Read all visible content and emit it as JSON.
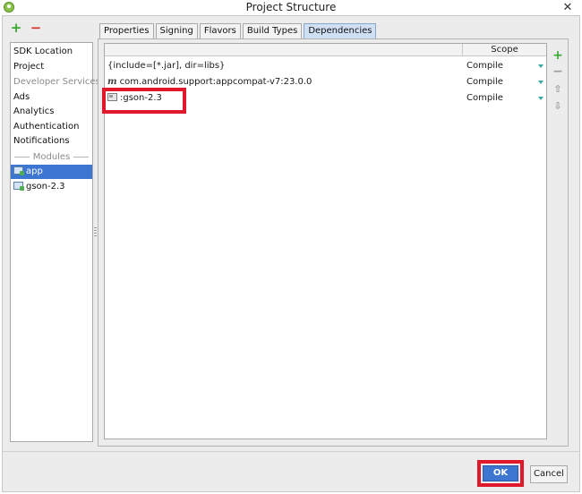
{
  "window": {
    "title": "Project Structure",
    "close_glyph": "✕"
  },
  "left_toolbar": {
    "add_glyph": "+",
    "remove_glyph": "−"
  },
  "sidebar": {
    "items": [
      {
        "label": "SDK Location"
      },
      {
        "label": "Project"
      },
      {
        "label": "Developer Services"
      },
      {
        "label": "Ads"
      },
      {
        "label": "Analytics"
      },
      {
        "label": "Authentication"
      },
      {
        "label": "Notifications"
      }
    ],
    "modules_label": "Modules",
    "modules": [
      {
        "label": "app",
        "selected": true
      },
      {
        "label": "gson-2.3",
        "selected": false
      }
    ]
  },
  "tabs": [
    {
      "label": "Properties"
    },
    {
      "label": "Signing"
    },
    {
      "label": "Flavors"
    },
    {
      "label": "Build Types"
    },
    {
      "label": "Dependencies",
      "active": true
    }
  ],
  "dependencies": {
    "scope_header": "Scope",
    "rows": [
      {
        "name": "{include=[*.jar], dir=libs}",
        "scope": "Compile",
        "icon": "none"
      },
      {
        "name": "com.android.support:appcompat-v7:23.0.0",
        "scope": "Compile",
        "icon": "maven-icon",
        "icon_glyph": "m"
      },
      {
        "name": ":gson-2.3",
        "scope": "Compile",
        "icon": "module-icon"
      }
    ]
  },
  "right_toolbar": {
    "add_glyph": "+",
    "remove_glyph": "−",
    "up_glyph": "⇧",
    "down_glyph": "⇩"
  },
  "buttons": {
    "ok_label": "OK",
    "cancel_label": "Cancel"
  },
  "colors": {
    "selection": "#3d76d1",
    "highlight": "#e0182b",
    "add": "#3aa832",
    "remove": "#d33a2c"
  }
}
